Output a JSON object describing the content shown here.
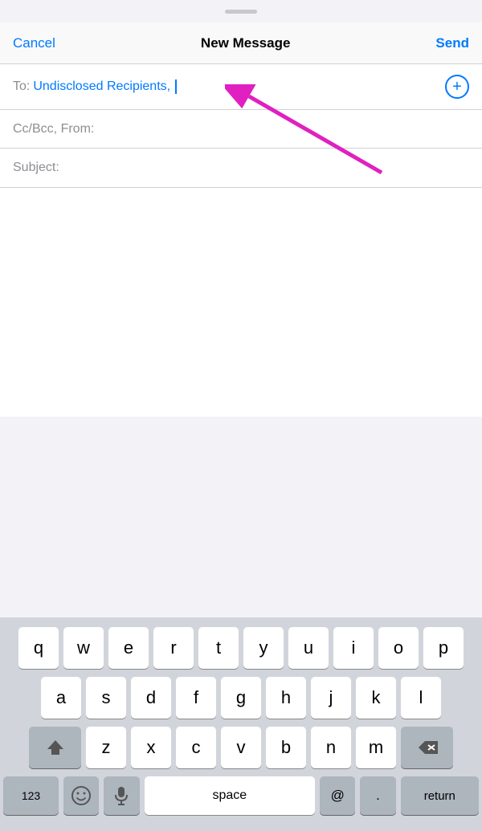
{
  "header": {
    "cancel_label": "Cancel",
    "title": "New Message",
    "send_label": "Send"
  },
  "compose": {
    "to_label": "To:",
    "to_value": "Undisclosed Recipients,",
    "cc_bcc_label": "Cc/Bcc, From:",
    "subject_label": "Subject:"
  },
  "keyboard": {
    "rows": [
      [
        "q",
        "w",
        "e",
        "r",
        "t",
        "y",
        "u",
        "i",
        "o",
        "p"
      ],
      [
        "a",
        "s",
        "d",
        "f",
        "g",
        "h",
        "j",
        "k",
        "l"
      ],
      [
        "z",
        "x",
        "c",
        "v",
        "b",
        "n",
        "m"
      ],
      [
        "123",
        "😊",
        "mic",
        "space",
        "@",
        ".",
        "return"
      ]
    ],
    "bottom_row_labels": {
      "num": "123",
      "space": "space",
      "at": "@",
      "period": ".",
      "return": "return"
    }
  },
  "colors": {
    "ios_blue": "#007aff",
    "arrow_pink": "#e020c0"
  }
}
